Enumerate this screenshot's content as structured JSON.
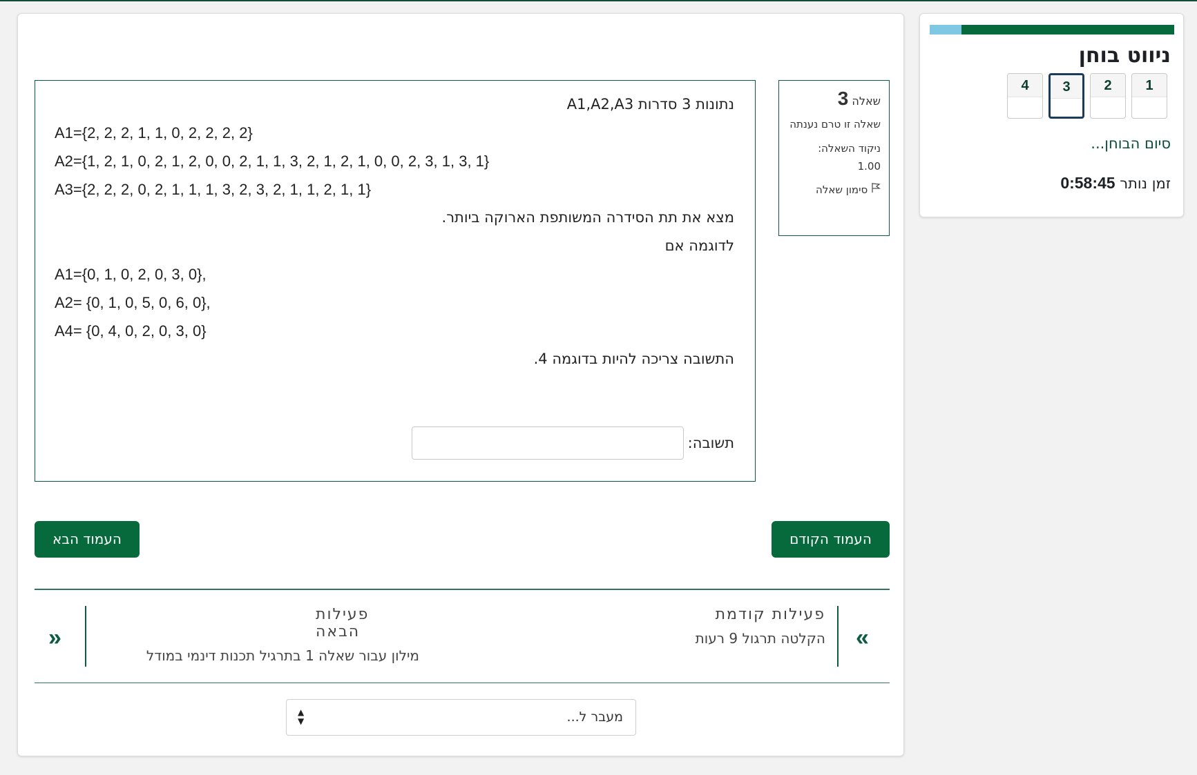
{
  "nav": {
    "title": "ניווט בוחן",
    "progress_fraction": 0.87,
    "questions": [
      "1",
      "2",
      "3",
      "4"
    ],
    "current_question": "3",
    "finish": "סיום הבוחן...",
    "timer_label": "זמן נותר",
    "timer_value": "0:58:45"
  },
  "question": {
    "label": "שאלה",
    "number": "3",
    "state": "שאלה זו טרם נענתה",
    "grade_label": "ניקוד השאלה:",
    "grade_value": "1.00",
    "flag": "סימון שאלה",
    "text": {
      "intro": "נתונות 3 סדרות A1,A2,A3",
      "a1": "A1={2, 2, 2, 1, 1, 0, 2, 2, 2, 2}",
      "a2": "A2={1, 2, 1, 0, 2, 1, 2, 0, 0, 2, 1, 1, 3, 2, 1, 2, 1, 0, 0, 2, 3, 1, 3, 1}",
      "a3": "A3={2, 2, 2, 0, 2, 1, 1, 1, 3, 2, 3, 2, 1, 1, 2, 1, 1}",
      "task": "מצא את תת הסידרה המשותפת הארוקה ביותר.",
      "example_intro": "לדוגמה אם",
      "ex1": "A1={0, 1, 0, 2, 0, 3, 0},",
      "ex2": "A2= {0, 1, 0, 5, 0, 6, 0},",
      "ex3": "A4= {0, 4, 0, 2, 0, 3, 0}",
      "example_answer": "התשובה צריכה להיות בדוגמה 4."
    },
    "answer_label": "תשובה:",
    "answer_value": ""
  },
  "buttons": {
    "prev": "העמוד הקודם",
    "next": "העמוד הבא"
  },
  "activity_nav": {
    "prev_title": "פעילות קודמת",
    "prev_name": "הקלטה תרגול 9 רעות",
    "next_title": "פעילות הבאה",
    "next_name": "מילון עבור שאלה 1 בתרגיל תכנות דינמי במודל"
  },
  "jump": {
    "label": "מעבר ל..."
  },
  "colors": {
    "primary": "#066a3d",
    "progress_bg": "#7ec8e3",
    "current_border": "#1b3c59"
  }
}
